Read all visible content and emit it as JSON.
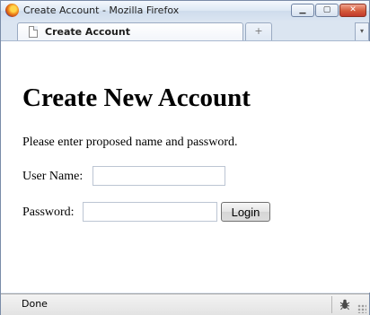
{
  "window": {
    "title": "Create Account - Mozilla Firefox"
  },
  "tabs": {
    "active_label": "Create Account",
    "new_tab_symbol": "+",
    "list_symbol": "▾"
  },
  "page": {
    "heading": "Create New Account",
    "intro": "Please enter proposed name and password.",
    "username_label": "User Name:",
    "username_value": "",
    "password_label": "Password:",
    "password_value": "",
    "login_label": "Login"
  },
  "status": {
    "text": "Done"
  },
  "icons": {
    "browser": "firefox-icon",
    "tab": "page-icon",
    "status": "bug-icon"
  }
}
